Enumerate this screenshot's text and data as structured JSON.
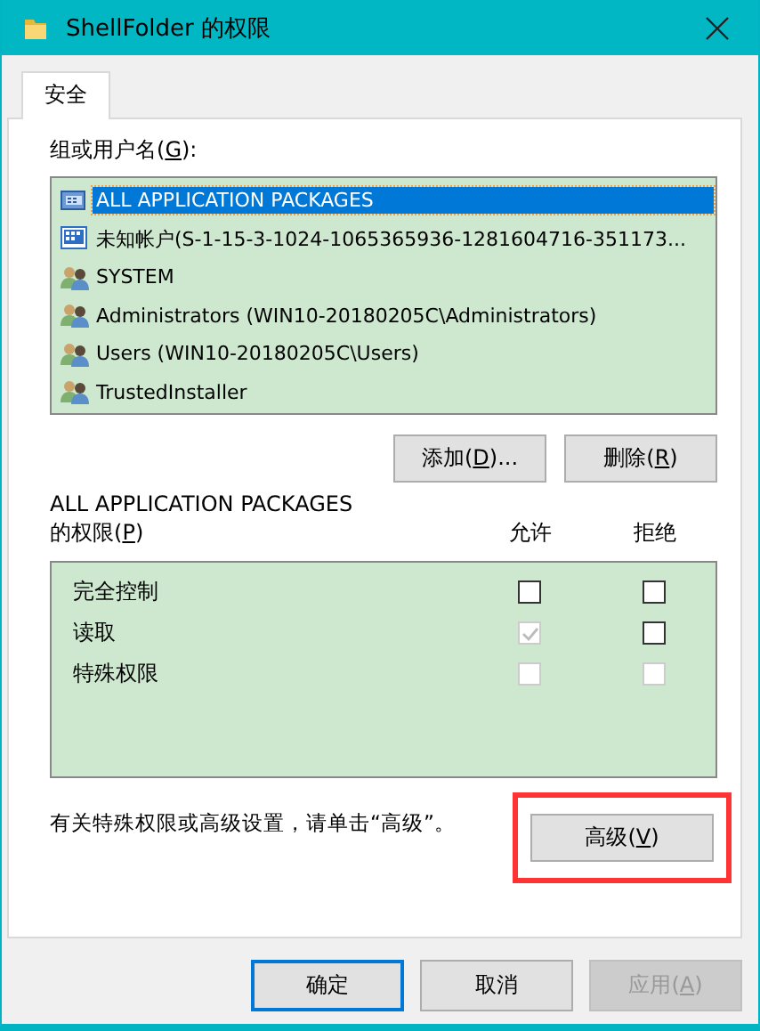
{
  "window": {
    "title": "ShellFolder 的权限"
  },
  "tabs": [
    {
      "label": "安全",
      "selected": true
    }
  ],
  "principals_label": {
    "before": "组或用户名(",
    "key": "G",
    "after": "):"
  },
  "principals": [
    {
      "kind": "package",
      "name": "ALL APPLICATION PACKAGES",
      "selected": true
    },
    {
      "kind": "unknown",
      "name": "未知帐户(S-1-15-3-1024-1065365936-1281604716-351173...",
      "selected": false
    },
    {
      "kind": "group",
      "name": "SYSTEM",
      "selected": false
    },
    {
      "kind": "group",
      "name": "Administrators (WIN10-20180205C\\Administrators)",
      "selected": false
    },
    {
      "kind": "group",
      "name": "Users (WIN10-20180205C\\Users)",
      "selected": false
    },
    {
      "kind": "group",
      "name": "TrustedInstaller",
      "selected": false
    }
  ],
  "principal_buttons": [
    {
      "before": "添加(",
      "key": "D",
      "after": ")..."
    },
    {
      "before": "删除(",
      "key": "R",
      "after": ")"
    }
  ],
  "permissions_title": "ALL APPLICATION PACKAGES",
  "permissions_label": {
    "before": "的权限(",
    "key": "P",
    "after": ")"
  },
  "columns": [
    "允许",
    "拒绝"
  ],
  "permissions": [
    {
      "name": "完全控制",
      "allow": {
        "checked": false,
        "disabled": false
      },
      "deny": {
        "checked": false,
        "disabled": false
      }
    },
    {
      "name": "读取",
      "allow": {
        "checked": true,
        "disabled": true
      },
      "deny": {
        "checked": false,
        "disabled": false
      }
    },
    {
      "name": "特殊权限",
      "allow": {
        "checked": false,
        "disabled": true
      },
      "deny": {
        "checked": false,
        "disabled": true
      }
    }
  ],
  "hint": "有关特殊权限或高级设置，请单击“高级”。",
  "advanced_button": {
    "before": "高级(",
    "key": "V",
    "after": ")",
    "highlighted": true
  },
  "footer_buttons": [
    {
      "before": "确定",
      "default": true,
      "disabled": false
    },
    {
      "before": "取消",
      "default": false,
      "disabled": false
    },
    {
      "before": "应用(",
      "key": "A",
      "after": ")",
      "default": false,
      "disabled": true
    }
  ]
}
